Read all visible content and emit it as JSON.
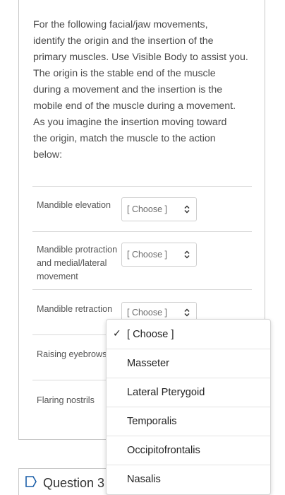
{
  "prompt": {
    "lines": [
      "For the following facial/jaw movements,",
      "identify the origin and the insertion of the",
      "primary muscles. Use Visible Body to assist you.",
      "The origin is the stable end of the muscle",
      "during a movement and the insertion is the",
      "mobile end of the muscle during a movement.",
      "As you imagine the insertion moving toward",
      "the origin, match the muscle to the action",
      "below:"
    ]
  },
  "rows": [
    {
      "label_lines": [
        "Mandible elevation"
      ],
      "select_value": "[ Choose ]"
    },
    {
      "label_lines": [
        "Mandible protraction",
        "and medial/lateral",
        "movement"
      ],
      "select_value": "[ Choose ]"
    },
    {
      "label_lines": [
        "Mandible retraction"
      ],
      "select_value": "[ Choose ]"
    },
    {
      "label_lines": [
        "Raising eyebrows"
      ]
    },
    {
      "label_lines": [
        "Flaring nostrils"
      ]
    }
  ],
  "dropdown": {
    "selected_icon": "checkmark-icon",
    "options": [
      "[ Choose ]",
      "Masseter",
      "Lateral Pterygoid",
      "Temporalis",
      "Occipitofrontalis",
      "Nasalis"
    ]
  },
  "next_question": {
    "icon": "flag-outline-icon",
    "label": "Question 3",
    "icon_color": "#1a5ea8"
  }
}
